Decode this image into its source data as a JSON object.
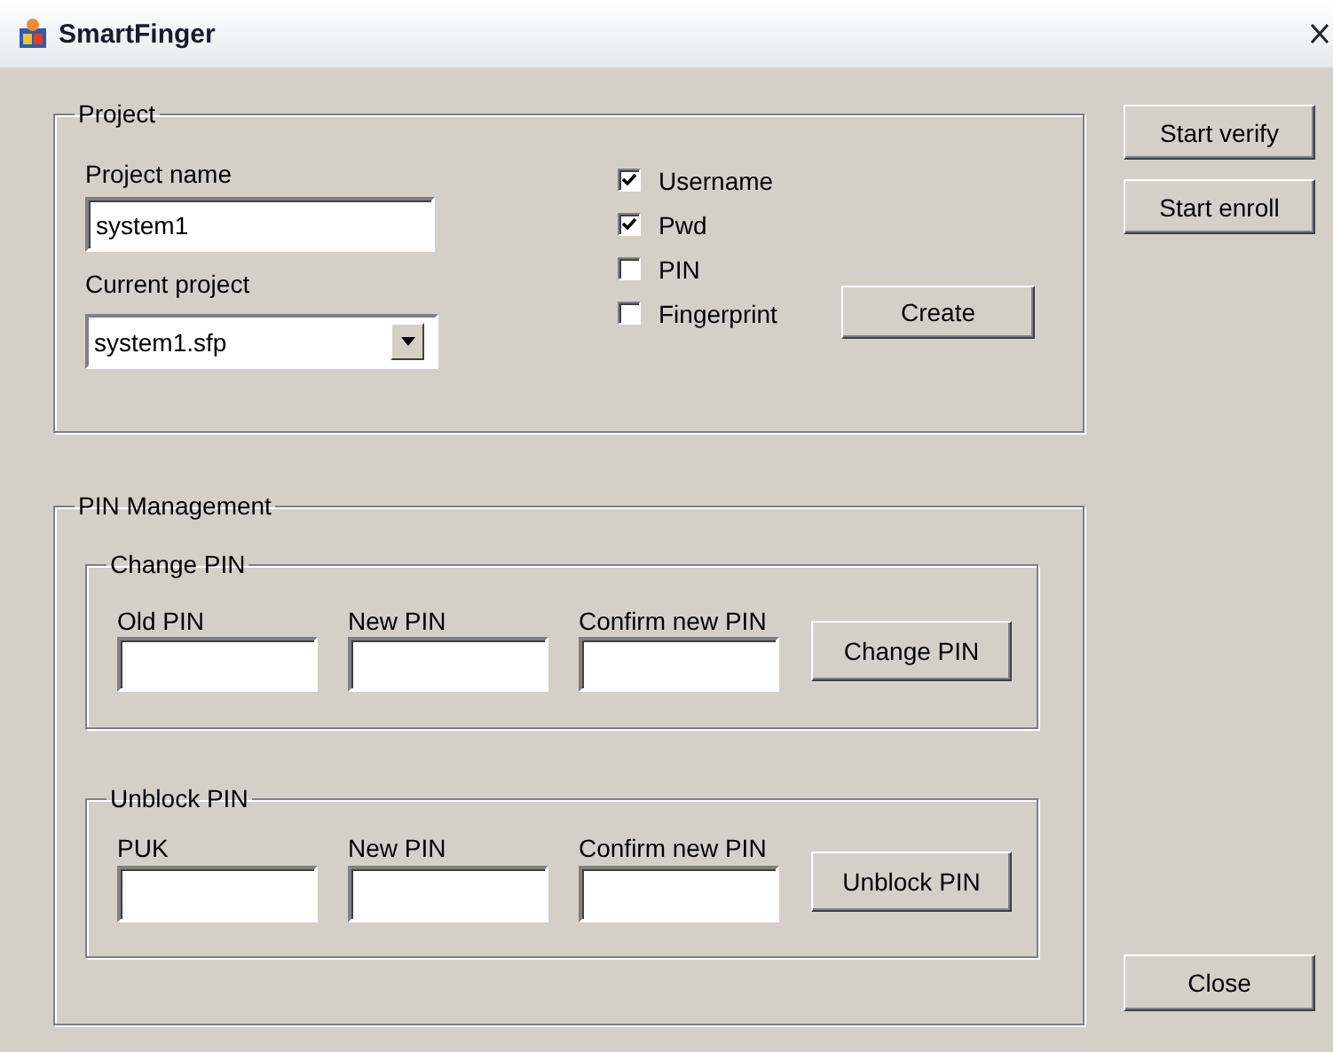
{
  "window": {
    "title": "SmartFinger"
  },
  "project": {
    "title": "Project",
    "project_name": {
      "label": "Project name",
      "value": "system1"
    },
    "current_project": {
      "label": "Current project",
      "value": "system1.sfp"
    },
    "options": [
      {
        "label": "Username",
        "checked": true
      },
      {
        "label": "Pwd",
        "checked": true
      },
      {
        "label": "PIN",
        "checked": false
      },
      {
        "label": "Fingerprint",
        "checked": false
      }
    ],
    "create_button": "Create"
  },
  "side_buttons": [
    "Start verify",
    "Start enroll"
  ],
  "pin_management": {
    "title": "PIN Management",
    "groups": [
      {
        "title": "Change PIN",
        "fields": [
          "Old PIN",
          "New PIN",
          "Confirm new PIN"
        ],
        "button": "Change PIN"
      },
      {
        "title": "Unblock PIN",
        "fields": [
          "PUK",
          "New PIN",
          "Confirm new PIN"
        ],
        "button": "Unblock PIN"
      }
    ]
  },
  "close_button": "Close"
}
